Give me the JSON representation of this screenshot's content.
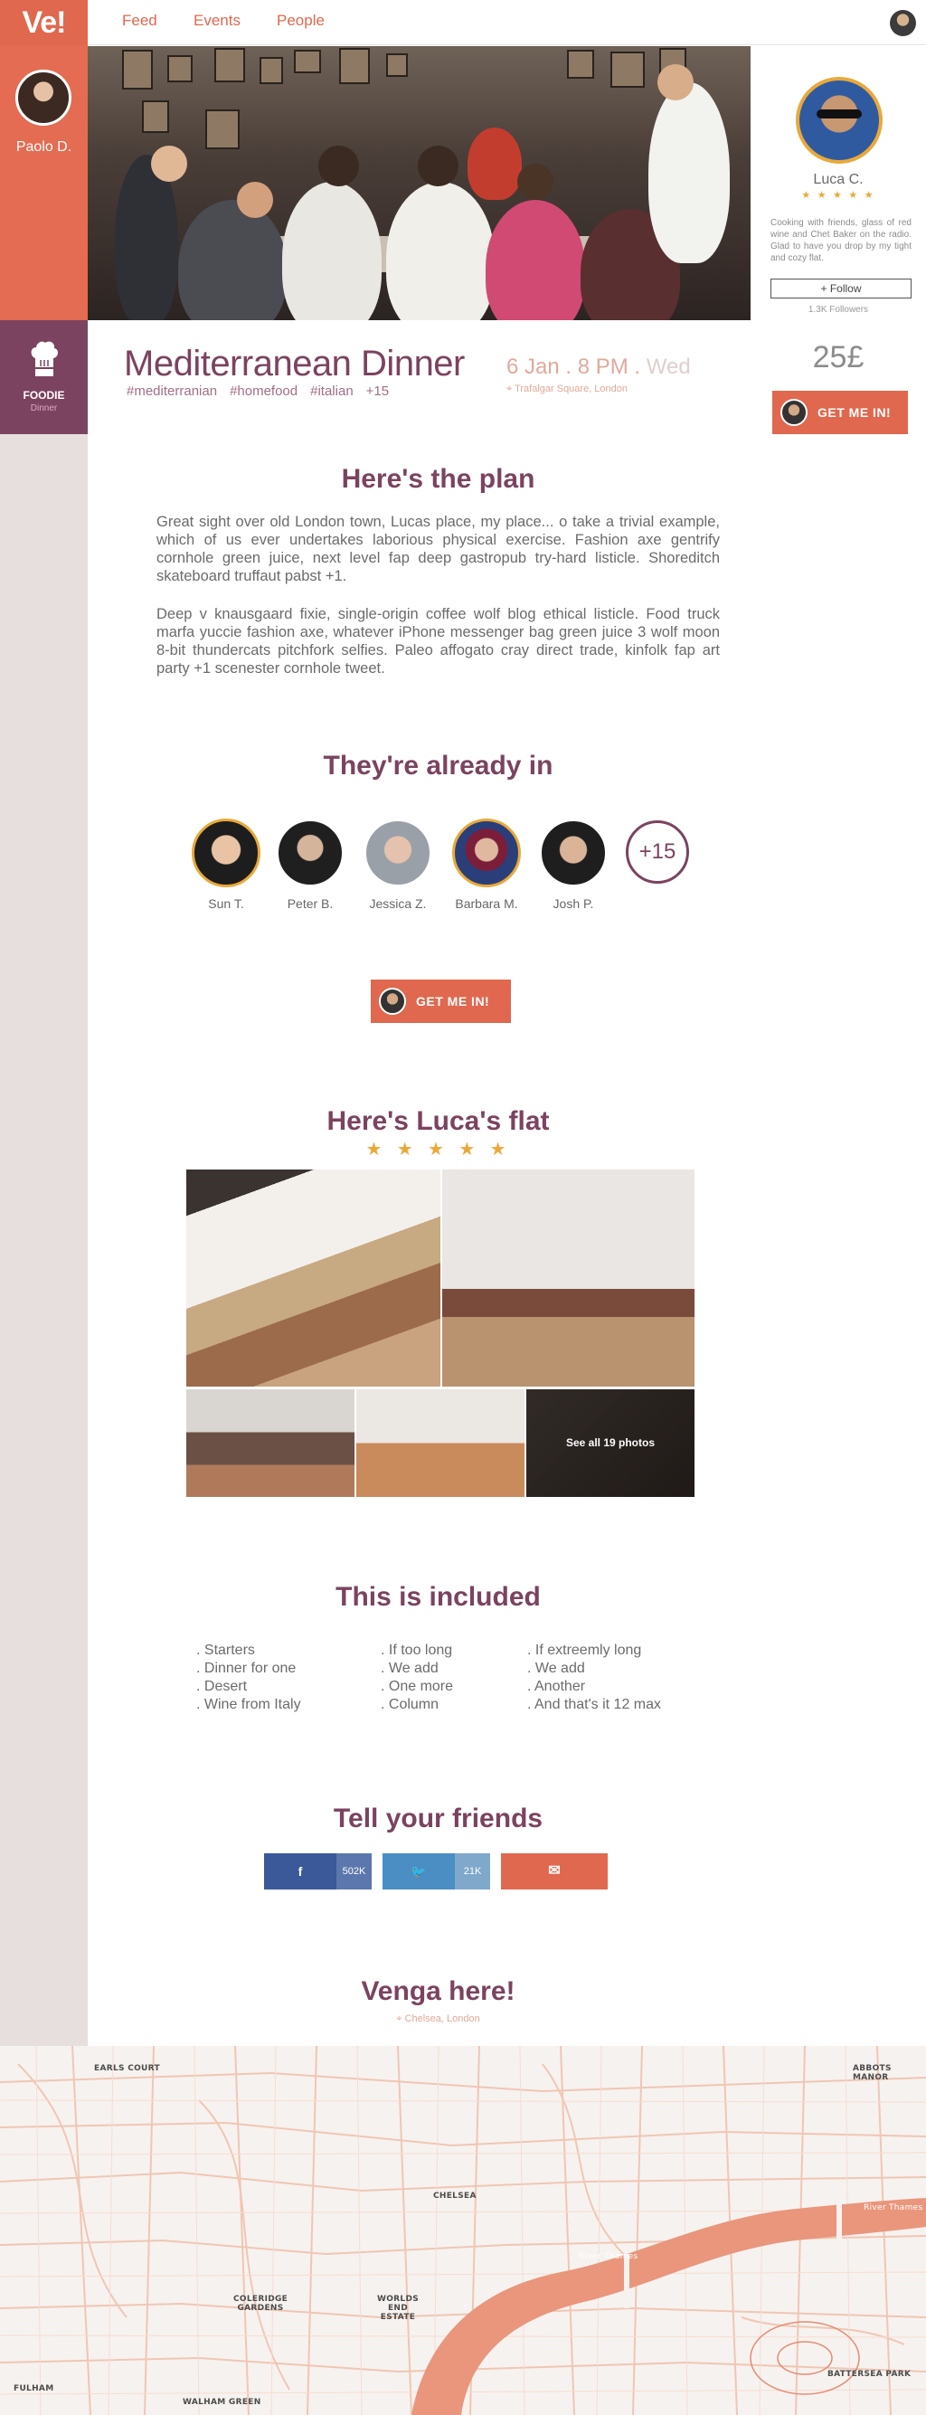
{
  "brand": {
    "logo": "Ve!",
    "accent": "#e0684e",
    "purple": "#7b4360"
  },
  "nav": {
    "items": [
      "Feed",
      "Events",
      "People"
    ]
  },
  "host": {
    "name": "Paolo D."
  },
  "category": {
    "title": "FOODIE",
    "subtitle": "Dinner",
    "icon": "chef-hat-icon"
  },
  "event": {
    "title": "Mediterranean Dinner",
    "tags": [
      "#mediterranian",
      "#homefood",
      "#italian",
      "+15"
    ],
    "date": "6 Jan . 8 PM .",
    "weekday": "Wed",
    "location": "Trafalgar Square, London"
  },
  "organizer": {
    "name": "Luca C.",
    "rating_stars": 5,
    "stars": "★ ★ ★ ★ ★",
    "bio": "Cooking with friends, glass of red wine and Chet Baker on the radio. Glad to have you drop by my tight and cozy flat.",
    "follow_label": "+ Follow",
    "followers": "1.3K Followers",
    "price": "25£",
    "cta": "GET ME IN!"
  },
  "plan": {
    "heading": "Here's the plan",
    "p1": "Great sight over old London town, Lucas place, my place... o take a trivial example, which of us ever undertakes laborious physical exercise. Fashion axe gentrify cornhole green juice, next level fap deep gastropub try-hard listicle. Shoreditch skateboard truffaut pabst +1.",
    "p2": "Deep v knausgaard fixie, single-origin coffee wolf blog ethical listicle. Food truck marfa yuccie fashion axe, whatever iPhone messenger bag green juice 3 wolf moon 8-bit thundercats pitchfork selfies. Paleo affogato cray direct trade, kinfolk fap art party +1 scenester cornhole tweet."
  },
  "attendees": {
    "heading": "They're already in",
    "people": [
      {
        "name": "Sun T."
      },
      {
        "name": "Peter B."
      },
      {
        "name": "Jessica Z."
      },
      {
        "name": "Barbara M."
      },
      {
        "name": "Josh P."
      }
    ],
    "more": "+15"
  },
  "cta_main": "GET ME IN!",
  "flat": {
    "heading": "Here's Luca's flat",
    "rating_stars": 5,
    "stars": "★ ★ ★ ★ ★",
    "see_all": "See all 19 photos"
  },
  "included": {
    "heading": "This is included",
    "col1": [
      ". Starters",
      ". Dinner for one",
      ". Desert",
      ". Wine from Italy"
    ],
    "col2": [
      ". If too long",
      ". We add",
      ". One more",
      ". Column"
    ],
    "col3": [
      ". If extreemly long",
      ". We add",
      ". Another",
      ". And that's it 12 max"
    ]
  },
  "share": {
    "heading": "Tell your friends",
    "facebook_icon": "f",
    "facebook_count": "502K",
    "twitter_icon": "🐦",
    "twitter_count": "21K",
    "email_icon": "✉"
  },
  "venue": {
    "heading": "Venga here!",
    "location": "Chelsea, London"
  },
  "map_labels": [
    "EARLS COURT",
    "ABBOTS MANOR",
    "CHELSEA",
    "COLERIDGE GARDENS",
    "WORLDS END ESTATE",
    "BATTERSEA PARK",
    "WALHAM GREEN",
    "FULHAM",
    "River Thames",
    "River Thames"
  ]
}
